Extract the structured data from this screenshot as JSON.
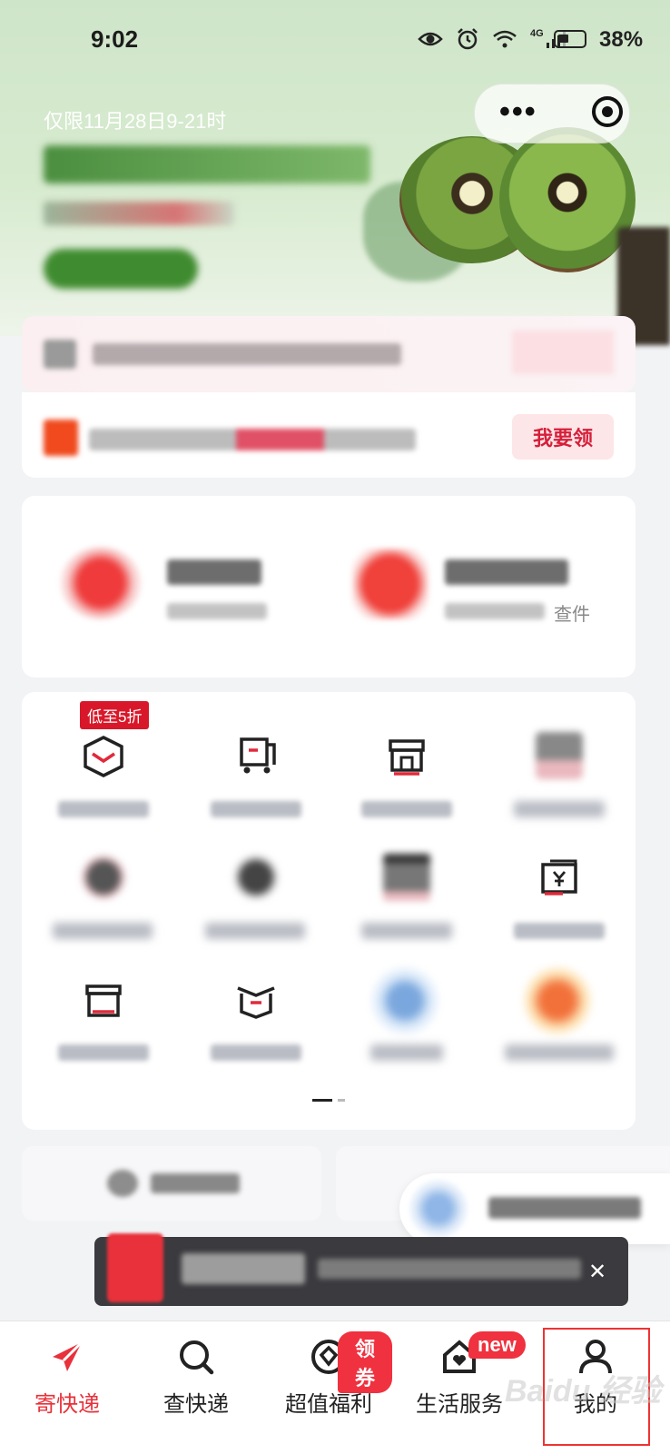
{
  "status_bar": {
    "time": "9:02",
    "network": "4G",
    "battery": "38%"
  },
  "banner": {
    "date_text": "仅限11月28日9-21时"
  },
  "notices": {
    "claim_button": "我要领"
  },
  "main_services": {
    "check_tail_text": "查件"
  },
  "grid": {
    "discount_badge": "低至5折"
  },
  "tabs": [
    {
      "label": "寄快递",
      "active": true
    },
    {
      "label": "查快递",
      "active": false
    },
    {
      "label": "超值福利",
      "active": false,
      "tag": "领券"
    },
    {
      "label": "生活服务",
      "active": false,
      "tag": "new"
    },
    {
      "label": "我的",
      "active": false
    }
  ],
  "watermark": "Baidu 经验",
  "colors": {
    "brand_red": "#e8313b",
    "tag_red": "#f0313f",
    "badge_red": "#d8182a",
    "banner_green": "#cfe5c9"
  }
}
